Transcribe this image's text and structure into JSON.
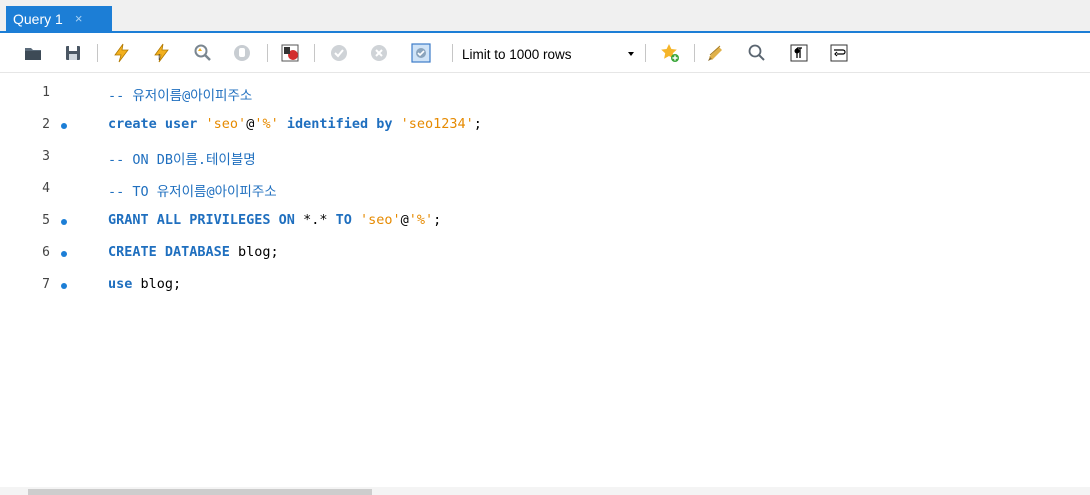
{
  "tab": {
    "title": "Query 1",
    "close": "×"
  },
  "toolbar": {
    "icons": [
      "open-folder-icon",
      "save-icon",
      "execute-icon",
      "execute-current-icon",
      "explain-icon",
      "stop-icon",
      "toggle-continue-on-error-icon",
      "commit-icon",
      "rollback-icon",
      "autocommit-icon",
      "add-snippet-icon",
      "beautify-icon",
      "find-icon",
      "invisible-chars-icon",
      "word-wrap-icon"
    ],
    "limit_label": "Limit to 1000 rows"
  },
  "editor": {
    "lines": [
      {
        "num": "1",
        "dot": false,
        "tokens": [
          {
            "t": "cm",
            "v": "-- 유저이름@아이피주소"
          }
        ]
      },
      {
        "num": "2",
        "dot": true,
        "tokens": [
          {
            "t": "kw",
            "v": "create user "
          },
          {
            "t": "str",
            "v": "'seo'"
          },
          {
            "t": "ident",
            "v": "@"
          },
          {
            "t": "str",
            "v": "'%'"
          },
          {
            "t": "kw",
            "v": " identified by "
          },
          {
            "t": "str",
            "v": "'seo1234'"
          },
          {
            "t": "ident",
            "v": ";"
          }
        ]
      },
      {
        "num": "3",
        "dot": false,
        "tokens": [
          {
            "t": "cm",
            "v": "-- ON DB이름.테이블명"
          }
        ]
      },
      {
        "num": "4",
        "dot": false,
        "tokens": [
          {
            "t": "cm",
            "v": "-- TO 유저이름@아이피주소"
          }
        ]
      },
      {
        "num": "5",
        "dot": true,
        "tokens": [
          {
            "t": "kw",
            "v": "GRANT ALL PRIVILEGES ON "
          },
          {
            "t": "ident",
            "v": "*.* "
          },
          {
            "t": "kw",
            "v": "TO "
          },
          {
            "t": "str",
            "v": "'seo'"
          },
          {
            "t": "ident",
            "v": "@"
          },
          {
            "t": "str",
            "v": "'%'"
          },
          {
            "t": "ident",
            "v": ";"
          }
        ]
      },
      {
        "num": "6",
        "dot": true,
        "tokens": [
          {
            "t": "kw",
            "v": "CREATE DATABASE "
          },
          {
            "t": "ident",
            "v": "blog;"
          }
        ]
      },
      {
        "num": "7",
        "dot": true,
        "tokens": [
          {
            "t": "kw",
            "v": "use "
          },
          {
            "t": "ident",
            "v": "blog;"
          }
        ]
      }
    ]
  }
}
